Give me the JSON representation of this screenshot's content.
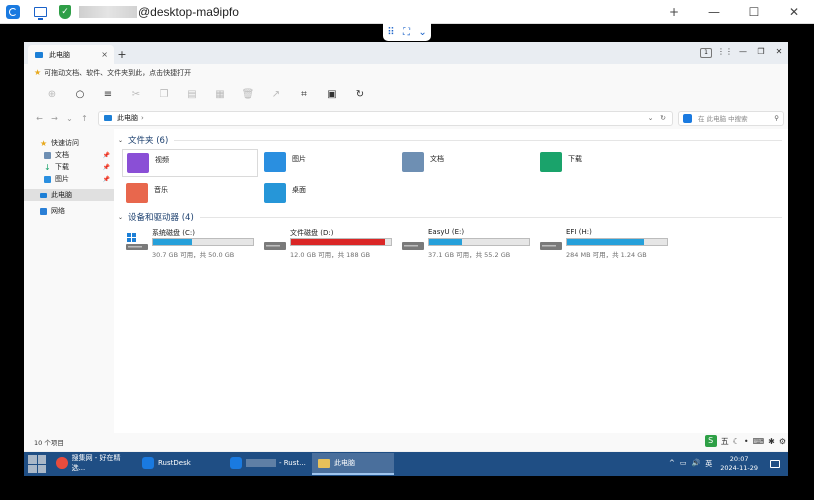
{
  "rustdesk": {
    "title": "@desktop-ma9ipfo",
    "win_buttons": [
      "+",
      "—",
      "☐",
      "✕"
    ]
  },
  "explorer": {
    "tab_title": "此电脑",
    "tab_close": "×",
    "tab_add": "+",
    "badge": "1",
    "win_controls": [
      "⋮⋮",
      "—",
      "❐",
      "✕"
    ],
    "info_bar": "可拖动文档、软件、文件夹到此，点击快捷打开",
    "address": "此电脑",
    "search_placeholder": "在 此电脑 中搜索",
    "sidebar": [
      {
        "label": "快速访问",
        "pinned": false,
        "sub": false
      },
      {
        "label": "文档",
        "pinned": true,
        "sub": true
      },
      {
        "label": "下载",
        "pinned": true,
        "sub": true
      },
      {
        "label": "图片",
        "pinned": true,
        "sub": true
      },
      {
        "label": "此电脑",
        "pinned": false,
        "sub": false
      },
      {
        "label": "网络",
        "pinned": false,
        "sub": false
      }
    ],
    "folders_heading": "文件夹 (6)",
    "folders": [
      {
        "label": "视频",
        "color": "#8a4fd6"
      },
      {
        "label": "图片",
        "color": "#2a8fe0"
      },
      {
        "label": "文档",
        "color": "#6e8fb3"
      },
      {
        "label": "下载",
        "color": "#1aa36b"
      },
      {
        "label": "音乐",
        "color": "#e8674d"
      },
      {
        "label": "桌面",
        "color": "#2696d8"
      }
    ],
    "drives_heading": "设备和驱动器 (4)",
    "drives": [
      {
        "label": "系统磁盘 (C:)",
        "size": "30.7 GB 可用，共 50.0 GB",
        "used_fraction": 0.39,
        "color": "#26a0da"
      },
      {
        "label": "文件磁盘 (D:)",
        "size": "12.0 GB 可用，共 188 GB",
        "used_fraction": 0.94,
        "color": "#da2626"
      },
      {
        "label": "EasyU (E:)",
        "size": "37.1 GB 可用，共 55.2 GB",
        "used_fraction": 0.33,
        "color": "#26a0da"
      },
      {
        "label": "EFI (H:)",
        "size": "284 MB 可用，共 1.24 GB",
        "used_fraction": 0.77,
        "color": "#26a0da"
      }
    ],
    "status": "10 个项目",
    "ime_tray": [
      "五",
      "☾",
      "•",
      "⌨",
      "✱",
      "⚙"
    ]
  },
  "taskbar": {
    "items": [
      {
        "label": "搜集网 - 好在精选...",
        "active": false,
        "icon_color": "#e84c3d"
      },
      {
        "label": "RustDesk",
        "active": false,
        "icon_color": "#1a7ae0"
      },
      {
        "label": "- Rust...",
        "active": false,
        "icon_color": "#1a7ae0"
      },
      {
        "label": "此电脑",
        "active": true,
        "icon_color": "#e8c15a"
      }
    ],
    "tray_icons": [
      "^",
      "▭",
      "🔊",
      "英"
    ],
    "time": "20:07",
    "date": "2024-11-29"
  }
}
